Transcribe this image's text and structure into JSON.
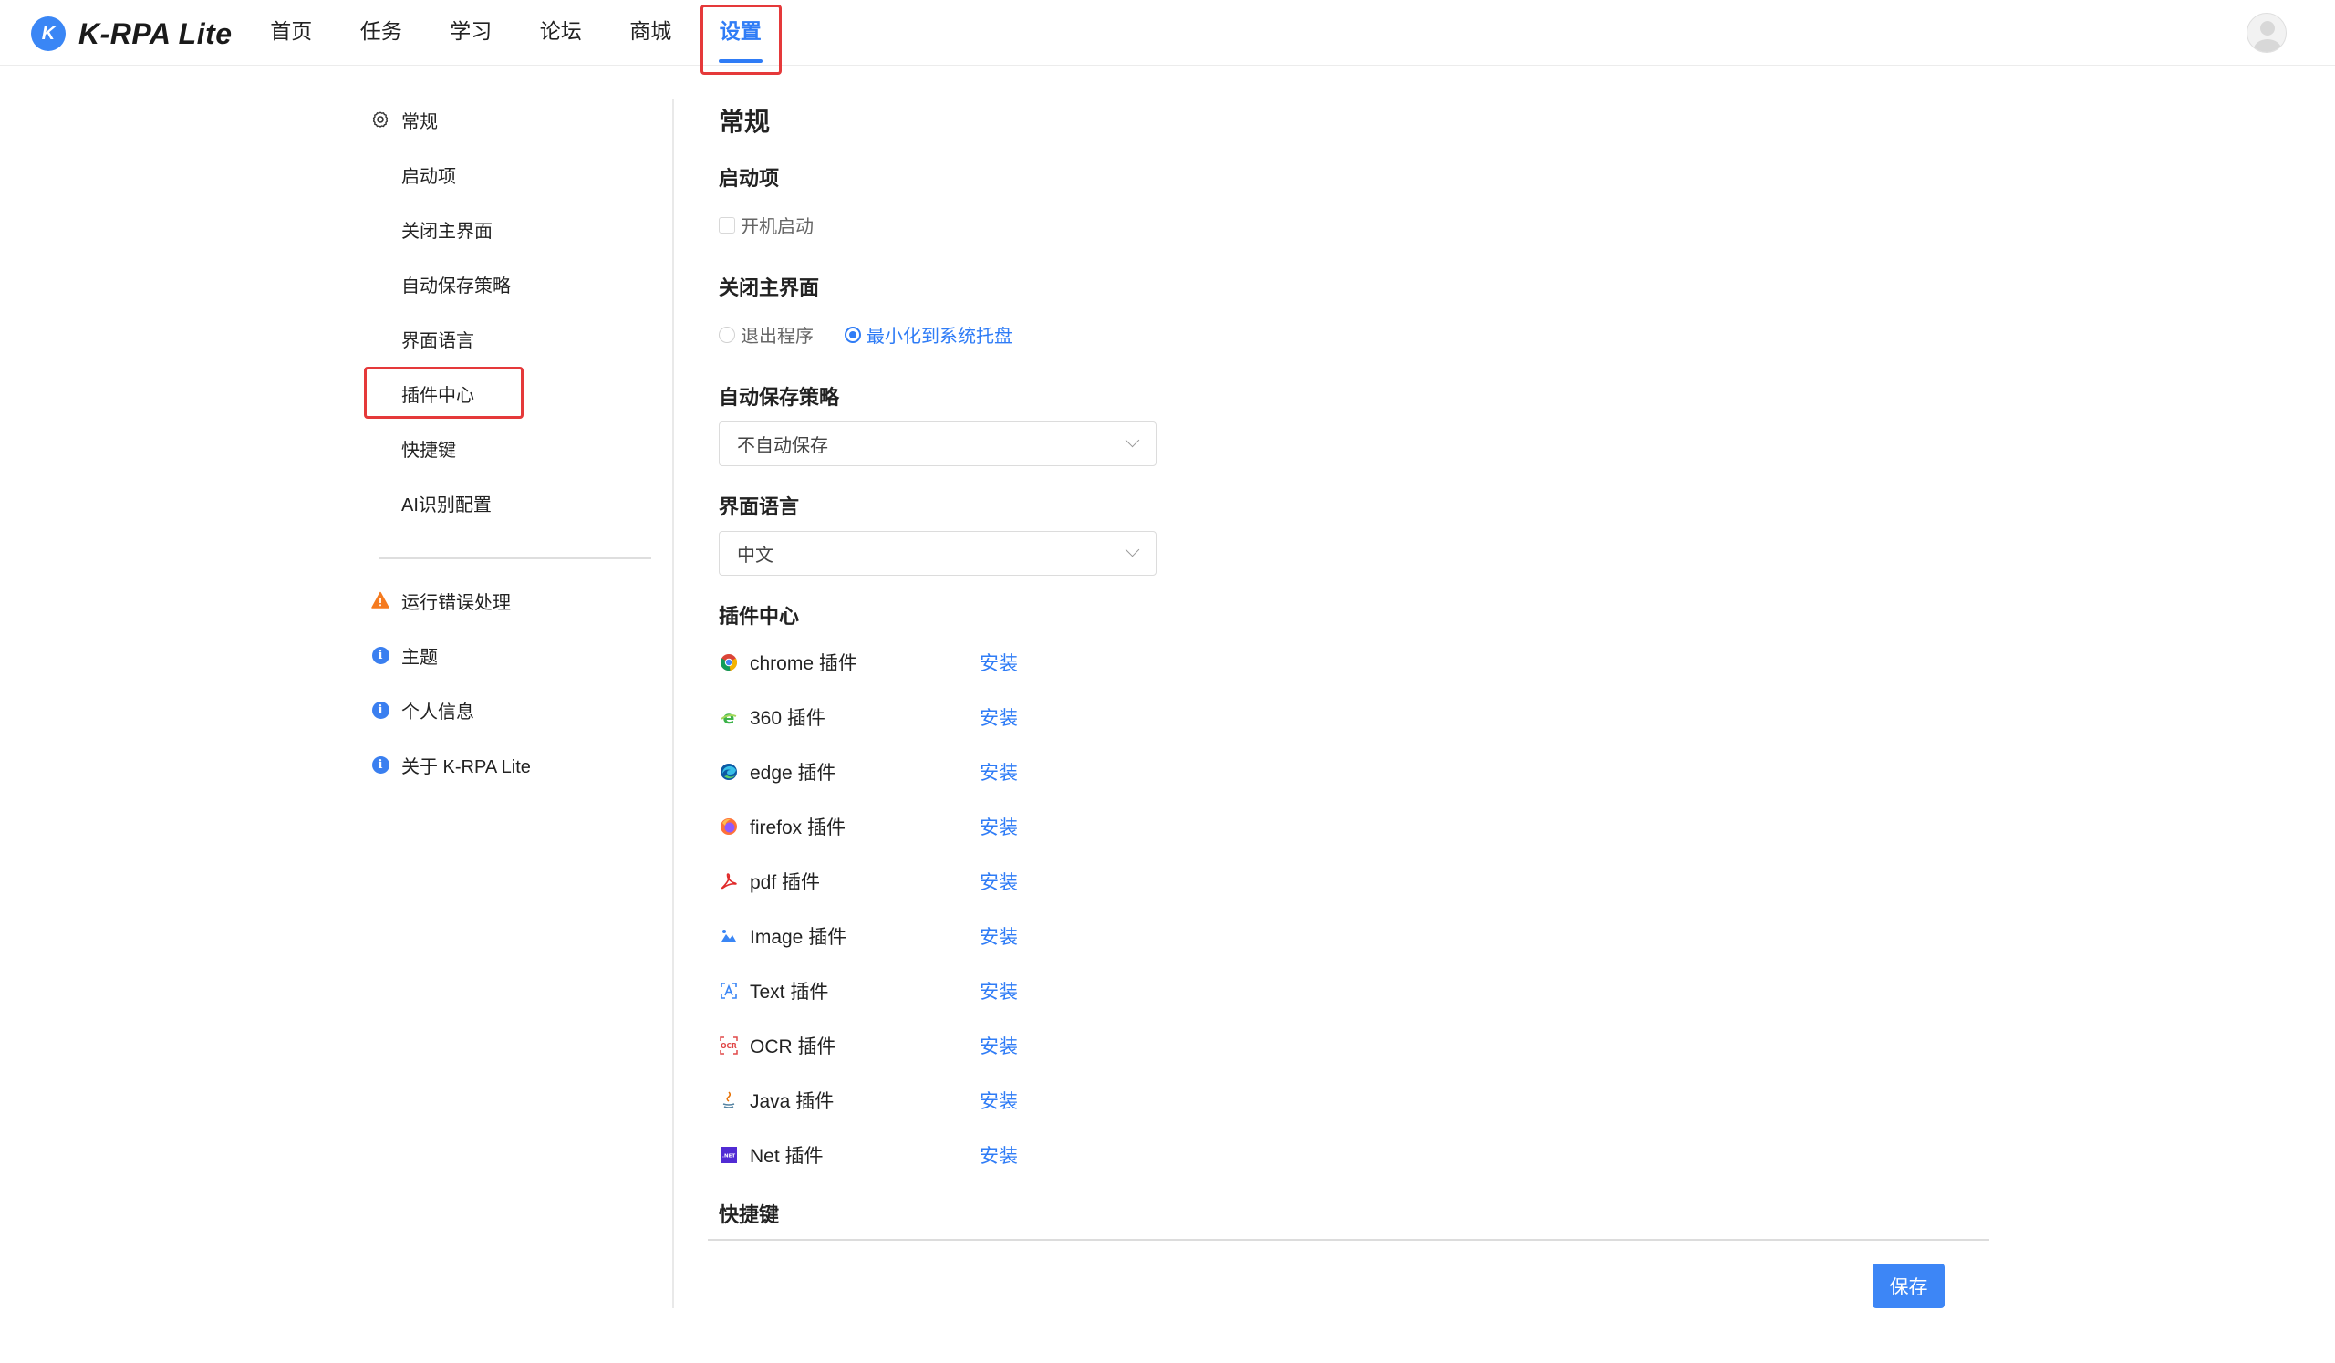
{
  "app": {
    "logo_letter": "K",
    "name": "K-RPA Lite",
    "accent": "#2f7cf6",
    "highlight": "#e5393a"
  },
  "nav": {
    "items": [
      "首页",
      "任务",
      "学习",
      "论坛",
      "商城",
      "设置"
    ],
    "active": "设置"
  },
  "sidebar": {
    "general": {
      "label": "常规",
      "icon": "gear-icon"
    },
    "sub_items": [
      "启动项",
      "关闭主界面",
      "自动保存策略",
      "界面语言",
      "插件中心",
      "快捷键",
      "AI识别配置"
    ],
    "highlighted": "插件中心",
    "other_items": [
      {
        "label": "运行错误处理",
        "icon": "warning-icon",
        "color": "#f57a1f"
      },
      {
        "label": "主题",
        "icon": "info-icon",
        "color": "#3a7ff0"
      },
      {
        "label": "个人信息",
        "icon": "info-icon",
        "color": "#3a7ff0"
      },
      {
        "label": "关于 K-RPA Lite",
        "icon": "info-icon",
        "color": "#3a7ff0"
      }
    ]
  },
  "main": {
    "title": "常规",
    "startup": {
      "title": "启动项",
      "checkbox_label": "开机启动",
      "checked": false
    },
    "close": {
      "title": "关闭主界面",
      "options": [
        "退出程序",
        "最小化到系统托盘"
      ],
      "selected": "最小化到系统托盘"
    },
    "autosave": {
      "title": "自动保存策略",
      "value": "不自动保存"
    },
    "language": {
      "title": "界面语言",
      "value": "中文"
    },
    "plugins": {
      "title": "插件中心",
      "action_label": "安装",
      "items": [
        {
          "name": "chrome 插件",
          "icon": "chrome-icon"
        },
        {
          "name": "360 插件",
          "icon": "360-browser-icon"
        },
        {
          "name": "edge 插件",
          "icon": "edge-icon"
        },
        {
          "name": "firefox 插件",
          "icon": "firefox-icon"
        },
        {
          "name": "pdf 插件",
          "icon": "pdf-icon"
        },
        {
          "name": "Image 插件",
          "icon": "image-icon"
        },
        {
          "name": "Text 插件",
          "icon": "text-icon"
        },
        {
          "name": "OCR 插件",
          "icon": "ocr-icon"
        },
        {
          "name": "Java 插件",
          "icon": "java-icon"
        },
        {
          "name": "Net 插件",
          "icon": "dotnet-icon"
        }
      ]
    },
    "shortcut": {
      "title": "快捷键"
    },
    "save_label": "保存"
  }
}
